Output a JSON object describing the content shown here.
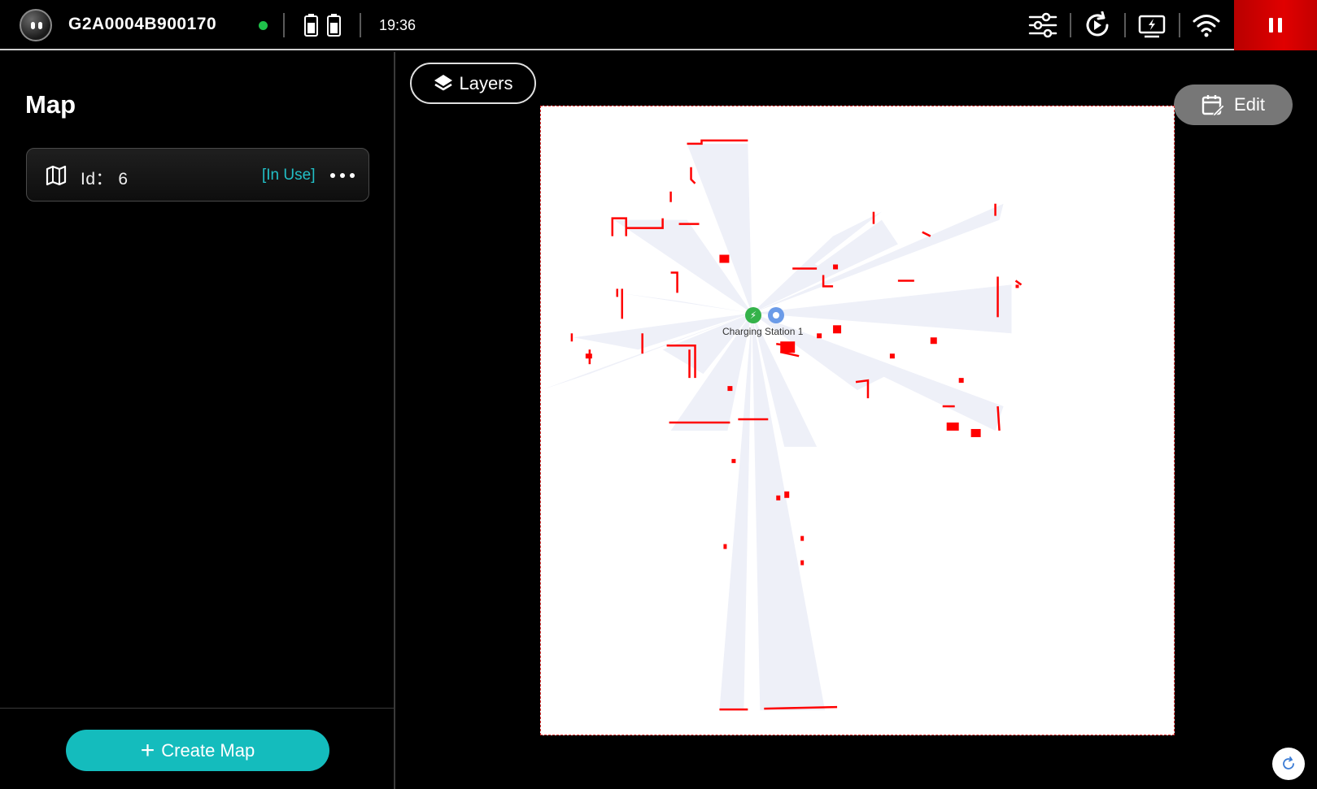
{
  "topbar": {
    "device_id": "G2A0004B900170",
    "time": "19:36",
    "status_color": "#1fc14a",
    "icons": [
      "robot-logo",
      "battery-icon",
      "battery-icon",
      "sliders-icon",
      "rotate-play-icon",
      "charging-screen-icon",
      "wifi-icon",
      "pause-icon"
    ]
  },
  "sidebar": {
    "title": "Map",
    "map_item": {
      "id_label": "Id： 6",
      "status": "[In Use]",
      "icon": "map-icon"
    },
    "create_button": {
      "label": "Create Map",
      "icon": "plus"
    }
  },
  "map_view": {
    "layers_button": "Layers",
    "edit_button": "Edit",
    "station_label": "Charging Station 1",
    "accent_color": "#14bcbd",
    "obstacle_color": "#ff0000"
  }
}
